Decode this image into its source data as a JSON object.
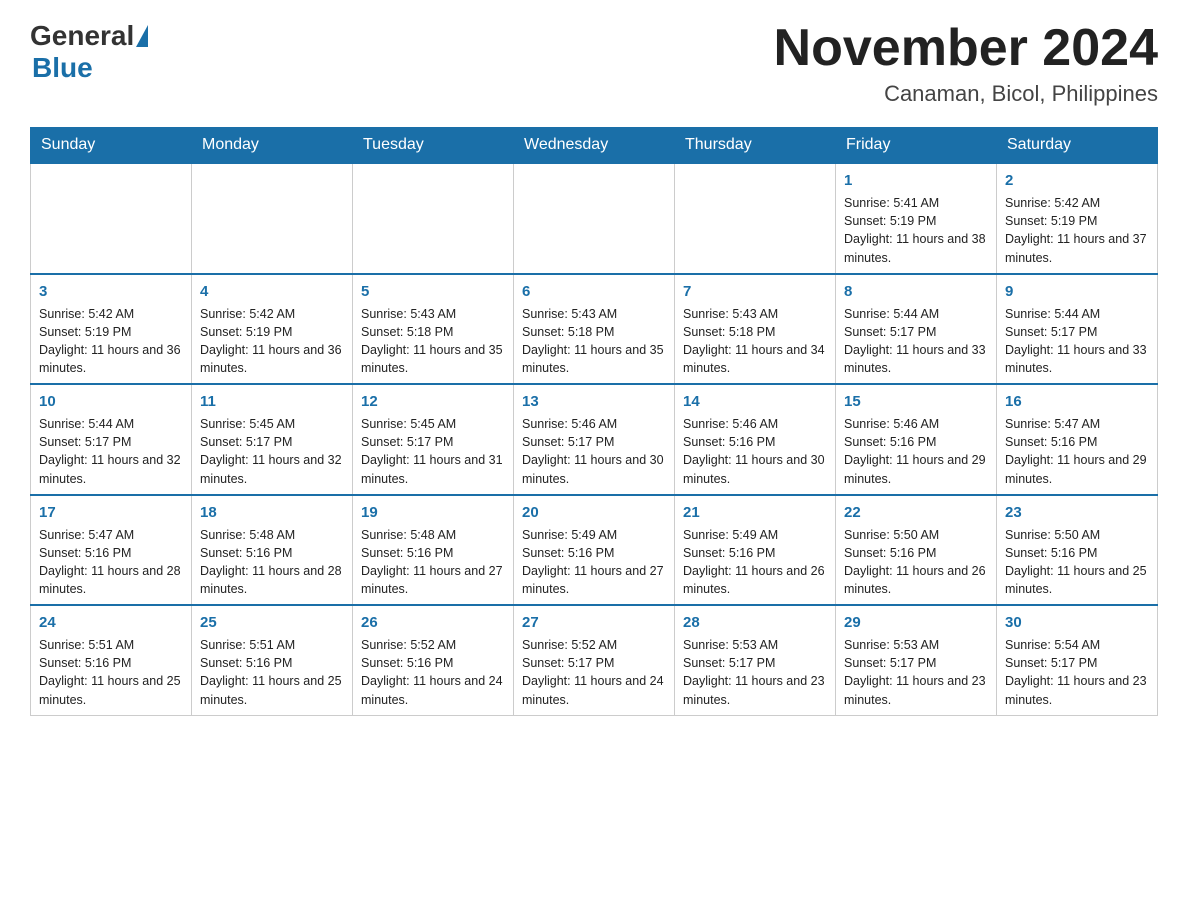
{
  "header": {
    "logo_general": "General",
    "logo_blue": "Blue",
    "month_title": "November 2024",
    "location": "Canaman, Bicol, Philippines"
  },
  "weekdays": [
    "Sunday",
    "Monday",
    "Tuesday",
    "Wednesday",
    "Thursday",
    "Friday",
    "Saturday"
  ],
  "weeks": [
    [
      {
        "day": "",
        "info": ""
      },
      {
        "day": "",
        "info": ""
      },
      {
        "day": "",
        "info": ""
      },
      {
        "day": "",
        "info": ""
      },
      {
        "day": "",
        "info": ""
      },
      {
        "day": "1",
        "info": "Sunrise: 5:41 AM\nSunset: 5:19 PM\nDaylight: 11 hours and 38 minutes."
      },
      {
        "day": "2",
        "info": "Sunrise: 5:42 AM\nSunset: 5:19 PM\nDaylight: 11 hours and 37 minutes."
      }
    ],
    [
      {
        "day": "3",
        "info": "Sunrise: 5:42 AM\nSunset: 5:19 PM\nDaylight: 11 hours and 36 minutes."
      },
      {
        "day": "4",
        "info": "Sunrise: 5:42 AM\nSunset: 5:19 PM\nDaylight: 11 hours and 36 minutes."
      },
      {
        "day": "5",
        "info": "Sunrise: 5:43 AM\nSunset: 5:18 PM\nDaylight: 11 hours and 35 minutes."
      },
      {
        "day": "6",
        "info": "Sunrise: 5:43 AM\nSunset: 5:18 PM\nDaylight: 11 hours and 35 minutes."
      },
      {
        "day": "7",
        "info": "Sunrise: 5:43 AM\nSunset: 5:18 PM\nDaylight: 11 hours and 34 minutes."
      },
      {
        "day": "8",
        "info": "Sunrise: 5:44 AM\nSunset: 5:17 PM\nDaylight: 11 hours and 33 minutes."
      },
      {
        "day": "9",
        "info": "Sunrise: 5:44 AM\nSunset: 5:17 PM\nDaylight: 11 hours and 33 minutes."
      }
    ],
    [
      {
        "day": "10",
        "info": "Sunrise: 5:44 AM\nSunset: 5:17 PM\nDaylight: 11 hours and 32 minutes."
      },
      {
        "day": "11",
        "info": "Sunrise: 5:45 AM\nSunset: 5:17 PM\nDaylight: 11 hours and 32 minutes."
      },
      {
        "day": "12",
        "info": "Sunrise: 5:45 AM\nSunset: 5:17 PM\nDaylight: 11 hours and 31 minutes."
      },
      {
        "day": "13",
        "info": "Sunrise: 5:46 AM\nSunset: 5:17 PM\nDaylight: 11 hours and 30 minutes."
      },
      {
        "day": "14",
        "info": "Sunrise: 5:46 AM\nSunset: 5:16 PM\nDaylight: 11 hours and 30 minutes."
      },
      {
        "day": "15",
        "info": "Sunrise: 5:46 AM\nSunset: 5:16 PM\nDaylight: 11 hours and 29 minutes."
      },
      {
        "day": "16",
        "info": "Sunrise: 5:47 AM\nSunset: 5:16 PM\nDaylight: 11 hours and 29 minutes."
      }
    ],
    [
      {
        "day": "17",
        "info": "Sunrise: 5:47 AM\nSunset: 5:16 PM\nDaylight: 11 hours and 28 minutes."
      },
      {
        "day": "18",
        "info": "Sunrise: 5:48 AM\nSunset: 5:16 PM\nDaylight: 11 hours and 28 minutes."
      },
      {
        "day": "19",
        "info": "Sunrise: 5:48 AM\nSunset: 5:16 PM\nDaylight: 11 hours and 27 minutes."
      },
      {
        "day": "20",
        "info": "Sunrise: 5:49 AM\nSunset: 5:16 PM\nDaylight: 11 hours and 27 minutes."
      },
      {
        "day": "21",
        "info": "Sunrise: 5:49 AM\nSunset: 5:16 PM\nDaylight: 11 hours and 26 minutes."
      },
      {
        "day": "22",
        "info": "Sunrise: 5:50 AM\nSunset: 5:16 PM\nDaylight: 11 hours and 26 minutes."
      },
      {
        "day": "23",
        "info": "Sunrise: 5:50 AM\nSunset: 5:16 PM\nDaylight: 11 hours and 25 minutes."
      }
    ],
    [
      {
        "day": "24",
        "info": "Sunrise: 5:51 AM\nSunset: 5:16 PM\nDaylight: 11 hours and 25 minutes."
      },
      {
        "day": "25",
        "info": "Sunrise: 5:51 AM\nSunset: 5:16 PM\nDaylight: 11 hours and 25 minutes."
      },
      {
        "day": "26",
        "info": "Sunrise: 5:52 AM\nSunset: 5:16 PM\nDaylight: 11 hours and 24 minutes."
      },
      {
        "day": "27",
        "info": "Sunrise: 5:52 AM\nSunset: 5:17 PM\nDaylight: 11 hours and 24 minutes."
      },
      {
        "day": "28",
        "info": "Sunrise: 5:53 AM\nSunset: 5:17 PM\nDaylight: 11 hours and 23 minutes."
      },
      {
        "day": "29",
        "info": "Sunrise: 5:53 AM\nSunset: 5:17 PM\nDaylight: 11 hours and 23 minutes."
      },
      {
        "day": "30",
        "info": "Sunrise: 5:54 AM\nSunset: 5:17 PM\nDaylight: 11 hours and 23 minutes."
      }
    ]
  ]
}
